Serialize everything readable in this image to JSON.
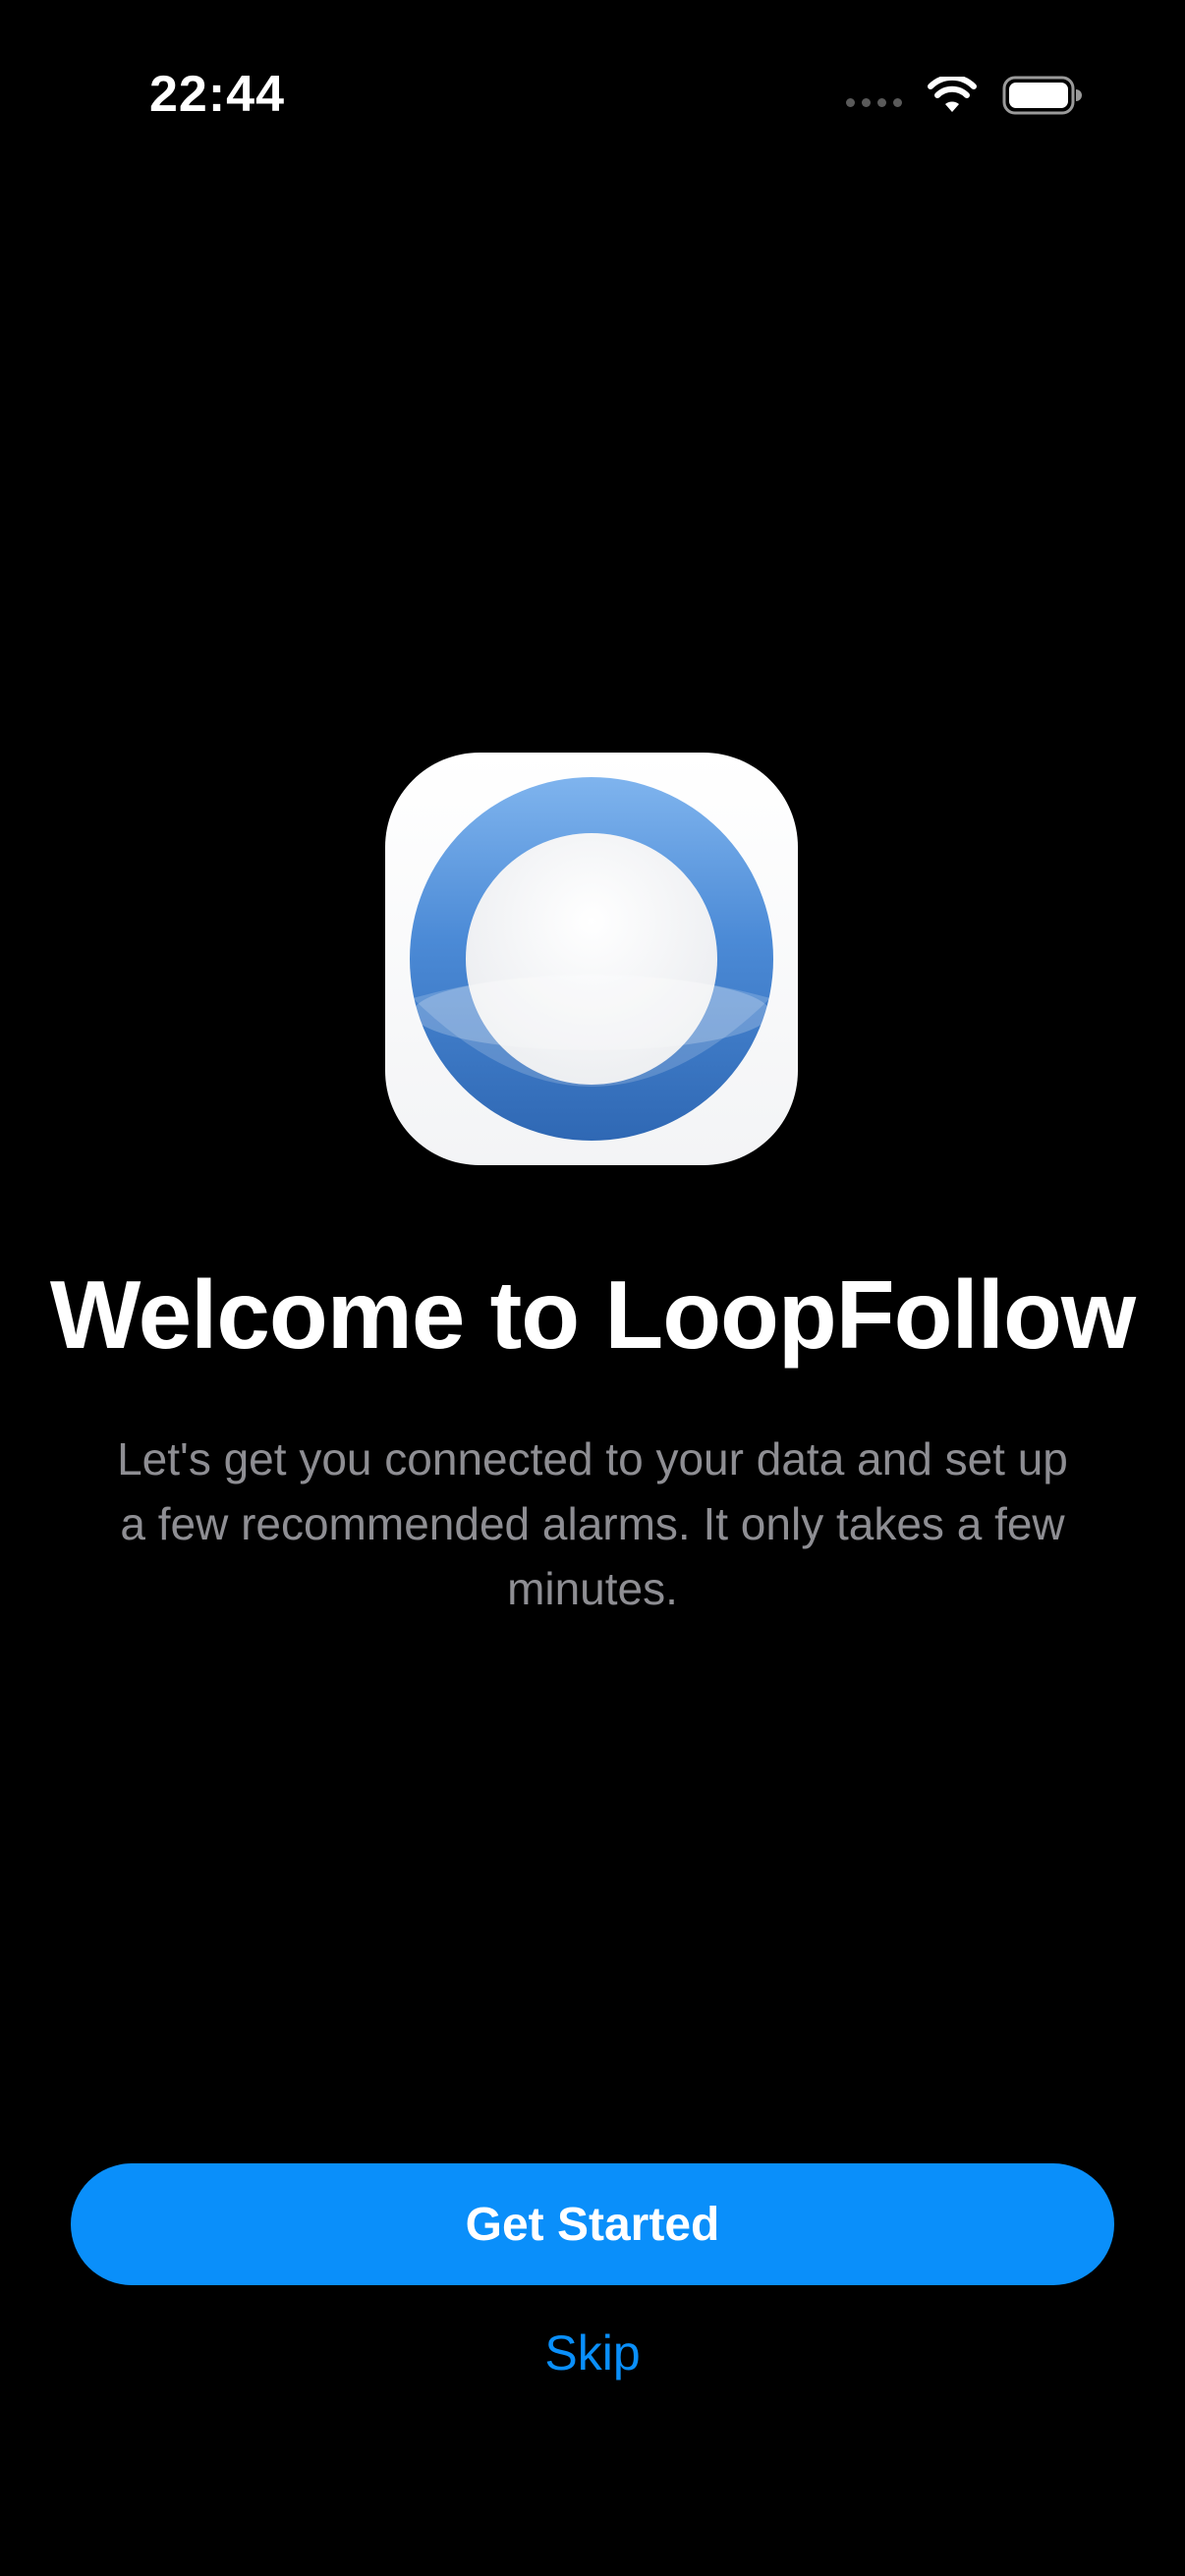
{
  "status_bar": {
    "time": "22:44",
    "icons": [
      "cellular-signal-icon",
      "wifi-icon",
      "battery-icon"
    ]
  },
  "welcome": {
    "app_icon": "loopfollow-logo",
    "title": "Welcome to LoopFollow",
    "body": "Let's get you connected to your data and set up a few recommended alarms. It only takes a few minutes."
  },
  "actions": {
    "primary_label": "Get Started",
    "skip_label": "Skip"
  },
  "colors": {
    "background": "#000000",
    "accent": "#0a8ffa",
    "secondary_text": "#8e8e93",
    "logo_ring": "#3d7fcc"
  }
}
